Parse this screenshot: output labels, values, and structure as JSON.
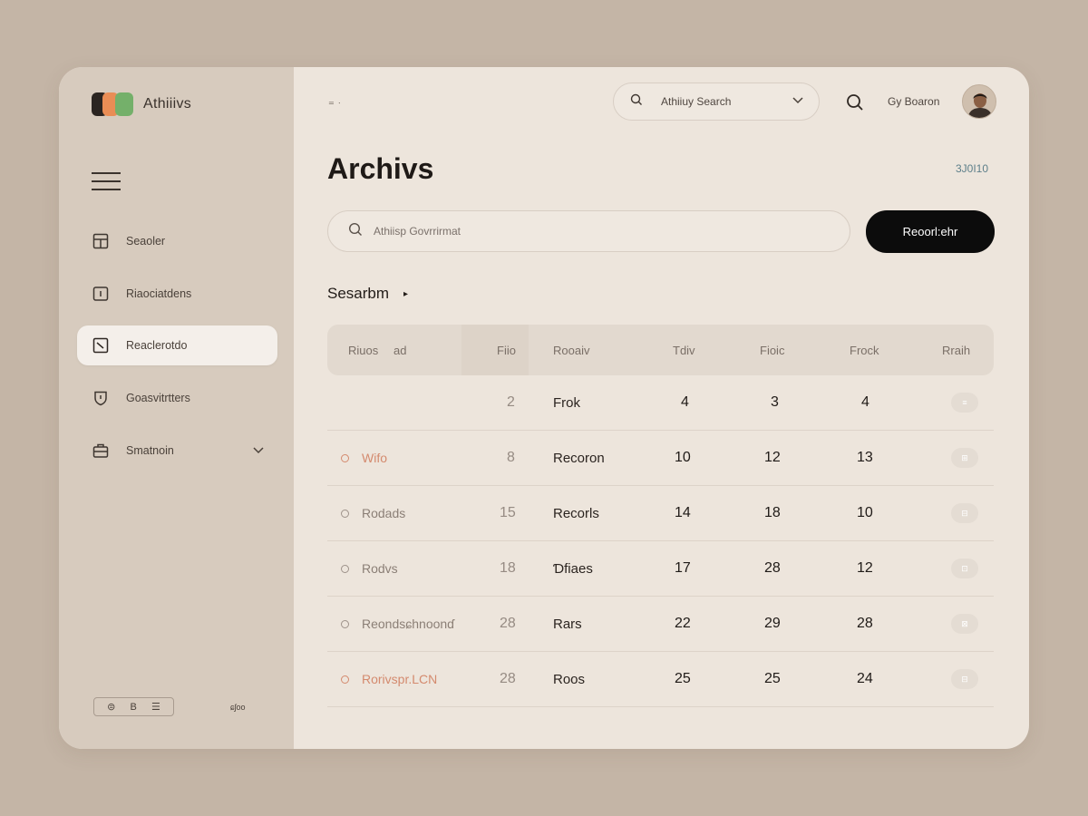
{
  "brand": {
    "name": "Athiiivs",
    "colors": [
      "#2b2521",
      "#e98d55",
      "#74b06a"
    ]
  },
  "sidebar": {
    "items": [
      {
        "label": "Seaoler",
        "icon": "layout-icon"
      },
      {
        "label": "Riaociatdens",
        "icon": "image-icon"
      },
      {
        "label": "Reaclerotdo",
        "icon": "open-box-icon",
        "active": true
      },
      {
        "label": "Goasvitrtters",
        "icon": "shield-icon"
      },
      {
        "label": "Smatnoin",
        "icon": "briefcase-icon",
        "has_chevron": true
      }
    ],
    "footer": {
      "tools": [
        "⊜",
        "B",
        "☰"
      ],
      "note": "ɕʃoo"
    }
  },
  "topbar": {
    "menu_glyph": "⁼ ˑ",
    "search_label": "Athiiuy Search",
    "link": "Gy Boaron"
  },
  "page": {
    "title": "Archivs",
    "meta": "3J0I10",
    "search_placeholder": "Athiisp Govrrirmat",
    "primary_button": "Reoorl:ehr",
    "sort_label": "Sesarbm",
    "sort_caret": "▸"
  },
  "table": {
    "headers": [
      "Riuos",
      "ad",
      "Fiio",
      "Rooaiv",
      "Tdiv",
      "Fioic",
      "Frock",
      "Rraih"
    ],
    "rows": [
      {
        "name": "",
        "icon": "",
        "num": "2",
        "text": "Frok",
        "a": "4",
        "b": "3",
        "c": "4",
        "pill": "≡",
        "accent": false
      },
      {
        "name": "Wifo",
        "icon": "circle-icon",
        "num": "8",
        "text": "Recoron",
        "a": "10",
        "b": "12",
        "c": "13",
        "pill": "⊞",
        "accent": true
      },
      {
        "name": "Rodads",
        "icon": "circle-icon",
        "num": "15",
        "text": "Recorls",
        "a": "14",
        "b": "18",
        "c": "10",
        "pill": "⊟",
        "accent": false
      },
      {
        "name": "Rodvs",
        "icon": "circle-icon",
        "num": "18",
        "text": "Ɗfiaes",
        "a": "17",
        "b": "28",
        "c": "12",
        "pill": "⊡",
        "accent": false
      },
      {
        "name": "Reondsɕhnoonɗ",
        "icon": "circle-icon",
        "num": "28",
        "text": "Rars",
        "a": "22",
        "b": "29",
        "c": "28",
        "pill": "⊠",
        "accent": false
      },
      {
        "name": "Rorivspr.LCN",
        "icon": "circle-icon",
        "num": "28",
        "text": "Roos",
        "a": "25",
        "b": "25",
        "c": "24",
        "pill": "⊟",
        "accent": true
      }
    ]
  },
  "colors": {
    "background": "#c4b5a6",
    "sidebar": "#d7cbbe",
    "panel": "#ede5dc",
    "primary_button": "#0c0c0c",
    "accent": "#d48a6e"
  }
}
